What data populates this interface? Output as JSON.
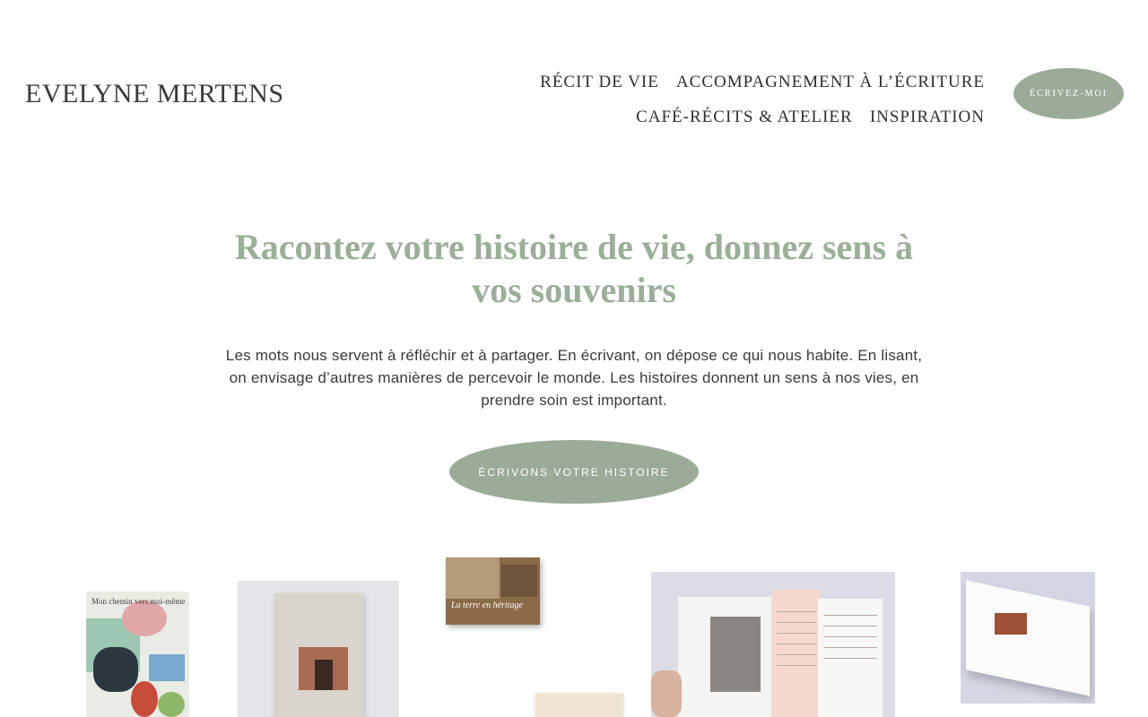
{
  "header": {
    "logo": "EVELYNE MERTENS",
    "nav": [
      {
        "label": "RÉCIT DE VIE"
      },
      {
        "label": "ACCOMPAGNEMENT À L’ÉCRITURE"
      },
      {
        "label": "CAFÉ-RÉCITS & ATELIER"
      },
      {
        "label": "INSPIRATION"
      }
    ],
    "cta_label": "ÉCRIVEZ-MOI"
  },
  "hero": {
    "title": "Racontez votre histoire de vie, donnez sens à vos souvenirs",
    "text": "Les mots nous servent à réfléchir et à partager. En écrivant, on dépose ce qui nous habite. En lisant, on envisage d’autres manières de percevoir le monde. Les histoires donnent un sens à nos vies, en prendre soin est important.",
    "cta_label": "ÉCRIVONS VOTRE HISTOIRE"
  },
  "gallery": {
    "book1_title": "Mon chemin vers moi-même",
    "book3_title": "La terre en héritage"
  },
  "colors": {
    "accent": "#9bab98",
    "title": "#9aae98"
  }
}
